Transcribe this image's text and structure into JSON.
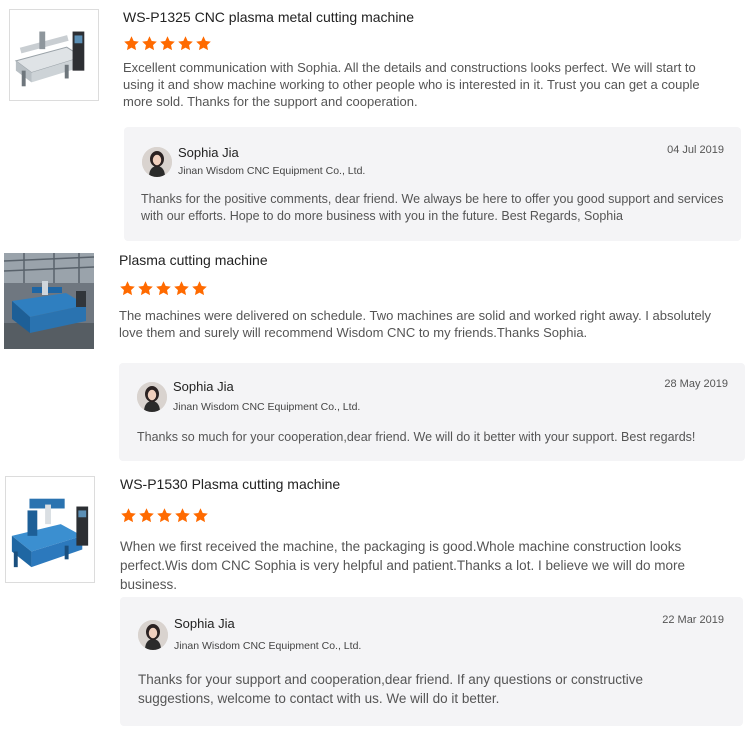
{
  "colors": {
    "star": "#ff6a00",
    "reply_bg": "#f4f4f6",
    "title_text": "#222222",
    "body_text": "#555555"
  },
  "reviews": [
    {
      "product_title": "WS-P1325 CNC plasma metal cutting machine",
      "rating": 5,
      "rating_max": 5,
      "comment": "Excellent communication with Sophia. All the details and constructions looks perfect. We will start to using it and show machine working to other people who is interested in it. Trust you can get a couple more sold. Thanks for the support and cooperation.",
      "thumbnail_icon": "cnc-machine-photo",
      "reply": {
        "name": "Sophia Jia",
        "company": "Jinan Wisdom CNC Equipment Co., Ltd.",
        "date": "04 Jul 2019",
        "text": "Thanks for the positive comments, dear friend. We always be here to offer you good support and services with our efforts. Hope to do more business with you in the future. Best Regards, Sophia"
      }
    },
    {
      "product_title": "Plasma cutting machine",
      "rating": 5,
      "rating_max": 5,
      "comment": "The machines were delivered on schedule. Two machines are solid and worked right away. I absolutely love them and surely will recommend Wisdom CNC to my friends.Thanks Sophia.",
      "thumbnail_icon": "workshop-machine-photo",
      "reply": {
        "name": "Sophia Jia",
        "company": "Jinan Wisdom CNC Equipment Co., Ltd.",
        "date": "28 May 2019",
        "text": "Thanks so much for your cooperation,dear friend. We will do it better with your support. Best regards!"
      }
    },
    {
      "product_title": "WS-P1530 Plasma cutting machine",
      "rating": 5,
      "rating_max": 5,
      "comment": "When we first received the machine, the packaging is good.Whole machine construction looks perfect.Wis dom CNC Sophia is very helpful and patient.Thanks a lot. I believe we will do more business.",
      "thumbnail_icon": "blue-plasma-machine-photo",
      "reply": {
        "name": "Sophia Jia",
        "company": "Jinan Wisdom CNC Equipment Co., Ltd.",
        "date": "22 Mar 2019",
        "text": "Thanks for your support and cooperation,dear friend. If any questions or constructive suggestions, welcome to contact with us. We will do it better."
      }
    }
  ]
}
